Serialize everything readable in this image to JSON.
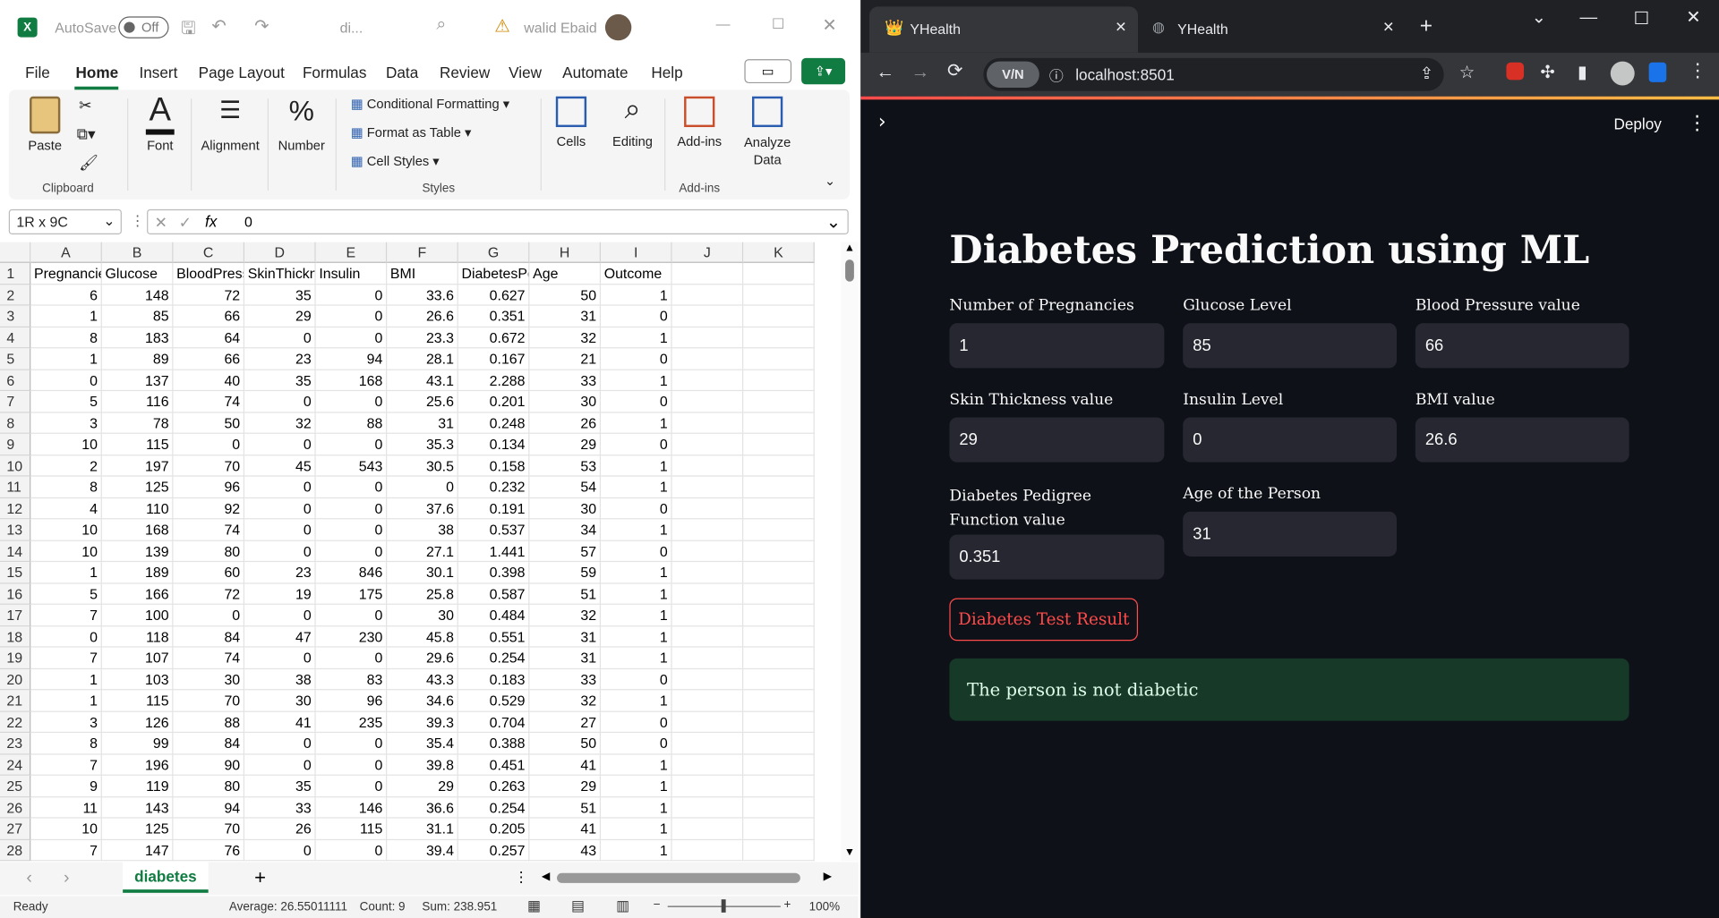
{
  "excel": {
    "autosave_label": "AutoSave",
    "autosave_state": "Off",
    "file_name": "di...",
    "user_name": "walid Ebaid",
    "menu": [
      "File",
      "Home",
      "Insert",
      "Page Layout",
      "Formulas",
      "Data",
      "Review",
      "View",
      "Automate",
      "Help"
    ],
    "active_menu": "Home",
    "ribbon": {
      "paste": "Paste",
      "clipboard": "Clipboard",
      "font": "Font",
      "alignment": "Alignment",
      "number": "Number",
      "conditional": "Conditional Formatting",
      "format_table": "Format as Table",
      "cell_styles": "Cell Styles",
      "styles": "Styles",
      "cells": "Cells",
      "editing": "Editing",
      "addins": "Add-ins",
      "addins_group": "Add-ins",
      "analyze": "Analyze Data"
    },
    "name_box": "1R x 9C",
    "formula_value": "0",
    "columns": [
      "A",
      "B",
      "C",
      "D",
      "E",
      "F",
      "G",
      "H",
      "I",
      "J",
      "K"
    ],
    "headers": [
      "Pregnancies",
      "Glucose",
      "BloodPressure",
      "SkinThickness",
      "Insulin",
      "BMI",
      "DiabetesPedigreeFunction",
      "Age",
      "Outcome"
    ],
    "rows": [
      [
        "6",
        "148",
        "72",
        "35",
        "0",
        "33.6",
        "0.627",
        "50",
        "1"
      ],
      [
        "1",
        "85",
        "66",
        "29",
        "0",
        "26.6",
        "0.351",
        "31",
        "0"
      ],
      [
        "8",
        "183",
        "64",
        "0",
        "0",
        "23.3",
        "0.672",
        "32",
        "1"
      ],
      [
        "1",
        "89",
        "66",
        "23",
        "94",
        "28.1",
        "0.167",
        "21",
        "0"
      ],
      [
        "0",
        "137",
        "40",
        "35",
        "168",
        "43.1",
        "2.288",
        "33",
        "1"
      ],
      [
        "5",
        "116",
        "74",
        "0",
        "0",
        "25.6",
        "0.201",
        "30",
        "0"
      ],
      [
        "3",
        "78",
        "50",
        "32",
        "88",
        "31",
        "0.248",
        "26",
        "1"
      ],
      [
        "10",
        "115",
        "0",
        "0",
        "0",
        "35.3",
        "0.134",
        "29",
        "0"
      ],
      [
        "2",
        "197",
        "70",
        "45",
        "543",
        "30.5",
        "0.158",
        "53",
        "1"
      ],
      [
        "8",
        "125",
        "96",
        "0",
        "0",
        "0",
        "0.232",
        "54",
        "1"
      ],
      [
        "4",
        "110",
        "92",
        "0",
        "0",
        "37.6",
        "0.191",
        "30",
        "0"
      ],
      [
        "10",
        "168",
        "74",
        "0",
        "0",
        "38",
        "0.537",
        "34",
        "1"
      ],
      [
        "10",
        "139",
        "80",
        "0",
        "0",
        "27.1",
        "1.441",
        "57",
        "0"
      ],
      [
        "1",
        "189",
        "60",
        "23",
        "846",
        "30.1",
        "0.398",
        "59",
        "1"
      ],
      [
        "5",
        "166",
        "72",
        "19",
        "175",
        "25.8",
        "0.587",
        "51",
        "1"
      ],
      [
        "7",
        "100",
        "0",
        "0",
        "0",
        "30",
        "0.484",
        "32",
        "1"
      ],
      [
        "0",
        "118",
        "84",
        "47",
        "230",
        "45.8",
        "0.551",
        "31",
        "1"
      ],
      [
        "7",
        "107",
        "74",
        "0",
        "0",
        "29.6",
        "0.254",
        "31",
        "1"
      ],
      [
        "1",
        "103",
        "30",
        "38",
        "83",
        "43.3",
        "0.183",
        "33",
        "0"
      ],
      [
        "1",
        "115",
        "70",
        "30",
        "96",
        "34.6",
        "0.529",
        "32",
        "1"
      ],
      [
        "3",
        "126",
        "88",
        "41",
        "235",
        "39.3",
        "0.704",
        "27",
        "0"
      ],
      [
        "8",
        "99",
        "84",
        "0",
        "0",
        "35.4",
        "0.388",
        "50",
        "0"
      ],
      [
        "7",
        "196",
        "90",
        "0",
        "0",
        "39.8",
        "0.451",
        "41",
        "1"
      ],
      [
        "9",
        "119",
        "80",
        "35",
        "0",
        "29",
        "0.263",
        "29",
        "1"
      ],
      [
        "11",
        "143",
        "94",
        "33",
        "146",
        "36.6",
        "0.254",
        "51",
        "1"
      ],
      [
        "10",
        "125",
        "70",
        "26",
        "115",
        "31.1",
        "0.205",
        "41",
        "1"
      ],
      [
        "7",
        "147",
        "76",
        "0",
        "0",
        "39.4",
        "0.257",
        "43",
        "1"
      ]
    ],
    "sheet_tab": "diabetes",
    "status_ready": "Ready",
    "status_average": "Average: 26.55011111",
    "status_count": "Count: 9",
    "status_sum": "Sum: 238.951",
    "zoom": "100%"
  },
  "browser": {
    "tabs": [
      "YHealth",
      "YHealth"
    ],
    "url": "localhost:8501",
    "vpn_label": "V/N",
    "deploy": "Deploy",
    "app_title": "Diabetes Prediction using ML",
    "fields": [
      {
        "label": "Number of Pregnancies",
        "value": "1"
      },
      {
        "label": "Glucose Level",
        "value": "85"
      },
      {
        "label": "Blood Pressure value",
        "value": "66"
      },
      {
        "label": "Skin Thickness value",
        "value": "29"
      },
      {
        "label": "Insulin Level",
        "value": "0"
      },
      {
        "label": "BMI value",
        "value": "26.6"
      },
      {
        "label": "Diabetes Pedigree Function value",
        "value": "0.351"
      },
      {
        "label": "Age of the Person",
        "value": "31"
      }
    ],
    "button": "Diabetes Test Result",
    "result": "The person is not diabetic"
  }
}
